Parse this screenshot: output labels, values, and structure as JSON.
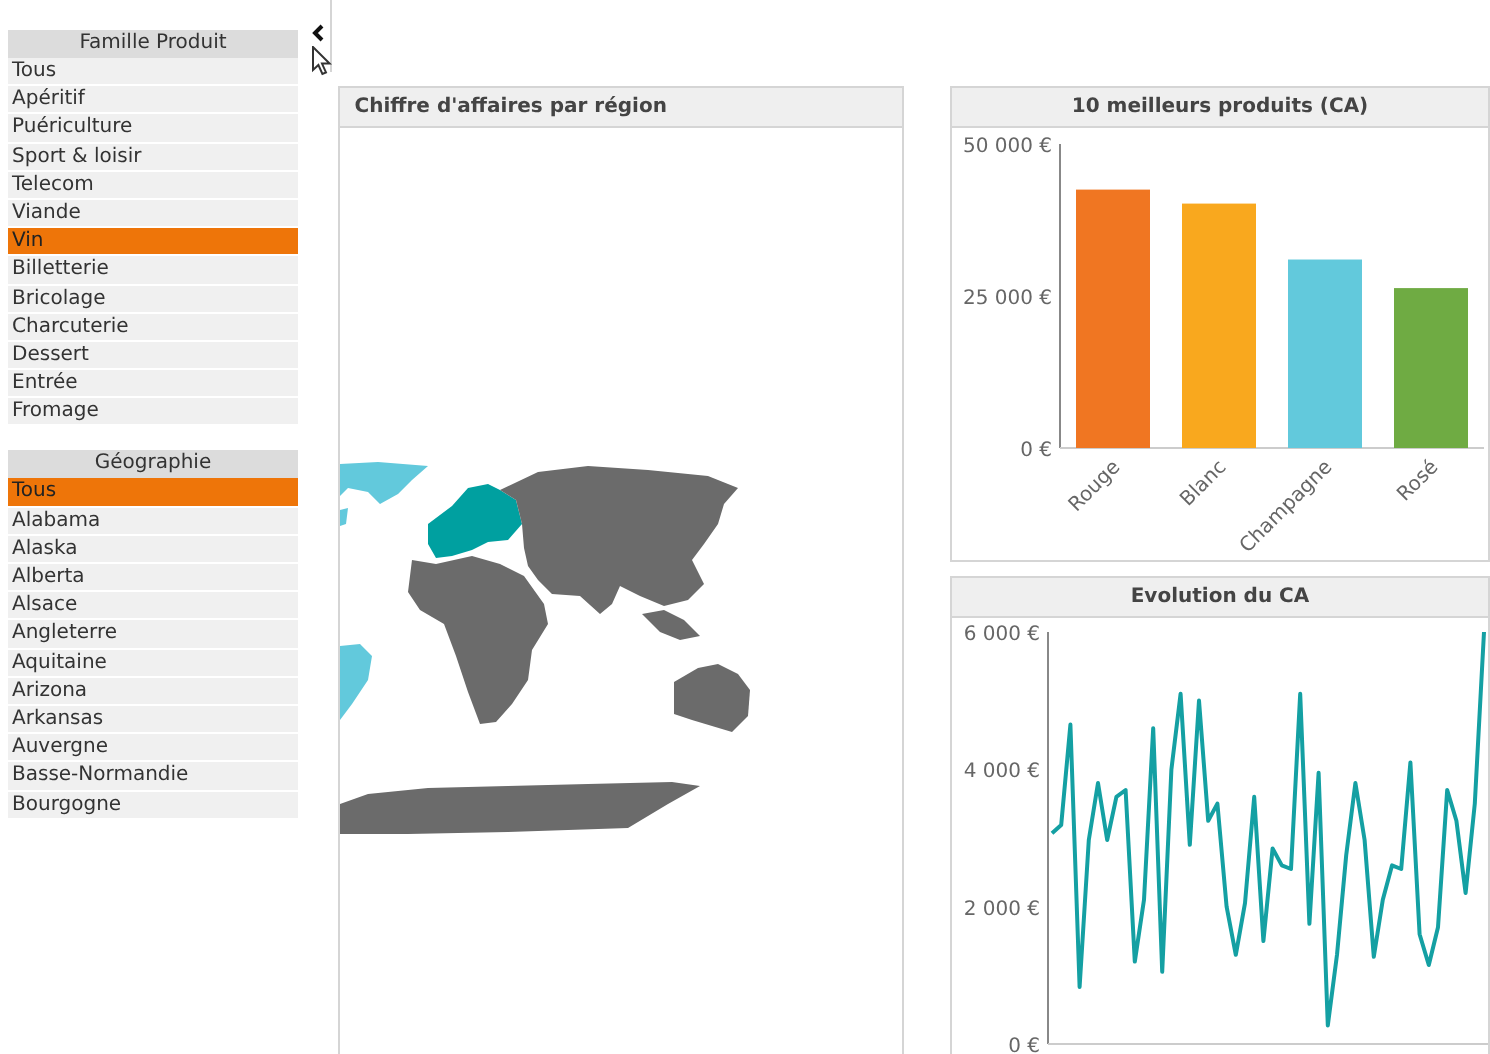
{
  "filters": [
    {
      "title": "Famille Produit",
      "items": [
        {
          "label": "Tous",
          "selected": false
        },
        {
          "label": "Apéritif",
          "selected": false
        },
        {
          "label": "Puériculture",
          "selected": false
        },
        {
          "label": "Sport & loisir",
          "selected": false
        },
        {
          "label": "Telecom",
          "selected": false
        },
        {
          "label": "Viande",
          "selected": false
        },
        {
          "label": "Vin",
          "selected": true
        },
        {
          "label": "Billetterie",
          "selected": false
        },
        {
          "label": "Bricolage",
          "selected": false
        },
        {
          "label": "Charcuterie",
          "selected": false
        },
        {
          "label": "Dessert",
          "selected": false
        },
        {
          "label": "Entrée",
          "selected": false
        },
        {
          "label": "Fromage",
          "selected": false
        }
      ]
    },
    {
      "title": "Géographie",
      "items": [
        {
          "label": "Tous",
          "selected": true
        },
        {
          "label": "Alabama",
          "selected": false
        },
        {
          "label": "Alaska",
          "selected": false
        },
        {
          "label": "Alberta",
          "selected": false
        },
        {
          "label": "Alsace",
          "selected": false
        },
        {
          "label": "Angleterre",
          "selected": false
        },
        {
          "label": "Aquitaine",
          "selected": false
        },
        {
          "label": "Arizona",
          "selected": false
        },
        {
          "label": "Arkansas",
          "selected": false
        },
        {
          "label": "Auvergne",
          "selected": false
        },
        {
          "label": "Basse-Normandie",
          "selected": false
        },
        {
          "label": "Bourgogne",
          "selected": false
        }
      ]
    }
  ],
  "map_panel": {
    "title": "Chiffre d'affaires par région"
  },
  "bar_panel": {
    "title": "10 meilleurs produits (CA)",
    "chart_data": {
      "type": "bar",
      "categories": [
        "Rouge",
        "Blanc",
        "Champagne",
        "Rosé"
      ],
      "stacked": true,
      "series": [
        {
          "color": "#f07622",
          "values": [
            42500,
            null,
            null,
            null
          ]
        },
        {
          "color": "#f9a81e",
          "values": [
            null,
            40200,
            null,
            null
          ]
        },
        {
          "color": "#62c9dc",
          "values": [
            null,
            null,
            31000,
            null
          ]
        },
        {
          "color": "#6fab43",
          "values": [
            null,
            null,
            null,
            26300
          ]
        }
      ],
      "ylim": [
        0,
        50000
      ],
      "yticks": [
        {
          "value": 0,
          "label": "0 €"
        },
        {
          "value": 25000,
          "label": "25 000 €"
        },
        {
          "value": 50000,
          "label": "50 000 €"
        }
      ]
    }
  },
  "line_panel": {
    "title": "Evolution du CA",
    "chart_data": {
      "type": "line",
      "series": [
        {
          "color": "#14a0a3",
          "values": [
            3070,
            3190,
            4650,
            830,
            2970,
            3800,
            2970,
            3600,
            3700,
            1200,
            2100,
            4600,
            1050,
            4000,
            5100,
            2900,
            5000,
            3250,
            3500,
            2000,
            1300,
            2050,
            3600,
            1500,
            2850,
            2600,
            2550,
            5100,
            1750,
            3950,
            270,
            1300,
            2750,
            3800,
            2970,
            1270,
            2100,
            2600,
            2550,
            4100,
            1600,
            1150,
            1700,
            3700,
            3250,
            2200,
            3500,
            6000
          ]
        }
      ],
      "ylim": [
        0,
        6000
      ],
      "yticks": [
        {
          "value": 0,
          "label": "0 €"
        },
        {
          "value": 2000,
          "label": "2 000 €"
        },
        {
          "value": 4000,
          "label": "4 000 €"
        },
        {
          "value": 6000,
          "label": "6 000 €"
        }
      ]
    }
  }
}
